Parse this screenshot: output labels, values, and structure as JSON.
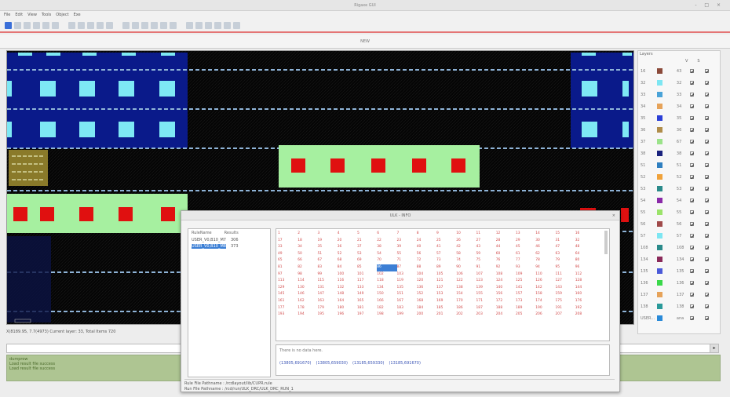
{
  "window": {
    "title": "Rigaxe GUI",
    "controls": "- □ ×"
  },
  "menu": [
    "File",
    "Edit",
    "View",
    "Tools",
    "Object",
    "Exe"
  ],
  "toolbar": {
    "icon_count": 26
  },
  "tab": {
    "label": "NEW"
  },
  "status": {
    "text": "X(8189.95, 7.7(4973)   Current layer: 33, Total Items 720"
  },
  "command": {
    "button": "▸"
  },
  "log": {
    "lines": [
      "dumprow",
      "Load result file success",
      "Load result file success"
    ]
  },
  "layers": {
    "title": "Layers",
    "columns": [
      "V",
      "S"
    ],
    "rows": [
      {
        "num": "16",
        "color": "#8b4a3a",
        "name": "43"
      },
      {
        "num": "32",
        "color": "#7de6f2",
        "name": "32"
      },
      {
        "num": "33",
        "color": "#4aa3d8",
        "name": "33"
      },
      {
        "num": "34",
        "color": "#e6a35a",
        "name": "34"
      },
      {
        "num": "35",
        "color": "#2b3fd6",
        "name": "35"
      },
      {
        "num": "36",
        "color": "#b08d4a",
        "name": "36"
      },
      {
        "num": "37",
        "color": "#9be38a",
        "name": "67"
      },
      {
        "num": "38",
        "color": "#1a237e",
        "name": "38"
      },
      {
        "num": "51",
        "color": "#2f7fc0",
        "name": "51"
      },
      {
        "num": "52",
        "color": "#f0a23a",
        "name": "52"
      },
      {
        "num": "53",
        "color": "#2a8a8a",
        "name": "53"
      },
      {
        "num": "54",
        "color": "#8a2aa8",
        "name": "54"
      },
      {
        "num": "55",
        "color": "#9be36a",
        "name": "55"
      },
      {
        "num": "56",
        "color": "#a04a4a",
        "name": "56"
      },
      {
        "num": "57",
        "color": "#7de6f2",
        "name": "57"
      },
      {
        "num": "108",
        "color": "#2a8a8a",
        "name": "108"
      },
      {
        "num": "134",
        "color": "#8a2a5a",
        "name": "134"
      },
      {
        "num": "135",
        "color": "#4a5ad8",
        "name": "135"
      },
      {
        "num": "136",
        "color": "#3ad84a",
        "name": "136"
      },
      {
        "num": "137",
        "color": "#e6a35a",
        "name": "137"
      },
      {
        "num": "138",
        "color": "#2a9a9a",
        "name": "138"
      },
      {
        "num": "USER...",
        "color": "#2a8ad8",
        "name": "ana"
      }
    ]
  },
  "dialog": {
    "title": "ULK - INFO",
    "close": "×",
    "list_headers": [
      "RuleName",
      "Results"
    ],
    "list_rows": [
      {
        "name": "USER_V0,B10_M7",
        "count": "306",
        "selected": false
      },
      {
        "name": "USER_V0,B10_M8",
        "count": "373",
        "selected": true
      }
    ],
    "grid_cols": 16,
    "selected_cell": "86",
    "info_text": "There is no data here.",
    "links": [
      "(13805,691670)",
      "(13805,659030)",
      "(13185,659330)",
      "(13185,691670)"
    ],
    "footer_lines": [
      "Rule File Pathname : /rcdlayout/lib/CUPR.rule",
      "Run File Pathname : /rcd/run/ULK_DRC/ULK_DRC_RUN_1"
    ]
  }
}
